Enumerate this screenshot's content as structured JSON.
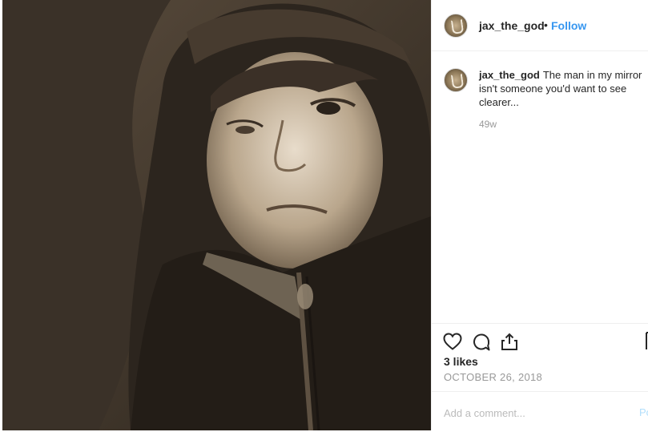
{
  "post": {
    "username": "jax_the_god",
    "follow_label": "Follow",
    "separator": "•",
    "caption_user": "jax_the_god",
    "caption_text": "The man in my mirror isn't someone you'd want to see clearer...",
    "time_ago": "49w",
    "likes": "3 likes",
    "date": "OCTOBER 26, 2018",
    "comment_placeholder": "Add a comment...",
    "post_label": "Post"
  },
  "photo": {
    "subject": "sepia-toned selfie of a person in a hooded jacket"
  },
  "colors": {
    "link_blue": "#3897f0",
    "muted_text": "#999999",
    "border": "#efefef"
  }
}
